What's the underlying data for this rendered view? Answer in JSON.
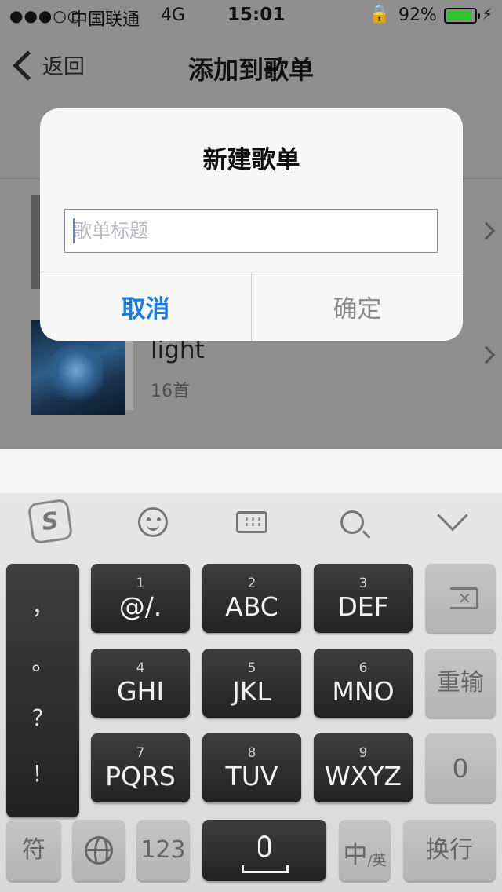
{
  "status": {
    "signal": "●●●○○",
    "carrier": "中国联通",
    "network": "4G",
    "time": "15:01",
    "lock_icon": "🔒",
    "battery_percent": "92%",
    "battery_level": 0.92,
    "charging_icon": "⚡"
  },
  "nav": {
    "back_label": "返回",
    "title": "添加到歌单"
  },
  "playlists": [
    {
      "name": "",
      "count": ""
    },
    {
      "name": "light",
      "count": "16首"
    }
  ],
  "dialog": {
    "title": "新建歌单",
    "input_value": "",
    "input_placeholder": "歌单标题",
    "cancel_label": "取消",
    "confirm_label": "确定"
  },
  "keyboard": {
    "logo_letter": "S",
    "punctuation": [
      "，",
      "。",
      "？",
      "！"
    ],
    "keys": [
      {
        "num": "1",
        "label": "@/."
      },
      {
        "num": "2",
        "label": "ABC"
      },
      {
        "num": "3",
        "label": "DEF"
      },
      {
        "num": "4",
        "label": "GHI"
      },
      {
        "num": "5",
        "label": "JKL"
      },
      {
        "num": "6",
        "label": "MNO"
      },
      {
        "num": "7",
        "label": "PQRS"
      },
      {
        "num": "8",
        "label": "TUV"
      },
      {
        "num": "9",
        "label": "WXYZ"
      }
    ],
    "reenter_label": "重输",
    "zero_label": "0",
    "symbol_label": "符",
    "numbers_label": "123",
    "lang_main": "中",
    "lang_sub": "/英",
    "return_label": "换行"
  },
  "colors": {
    "accent": "#1a7be0",
    "battery": "#2ec52e"
  }
}
